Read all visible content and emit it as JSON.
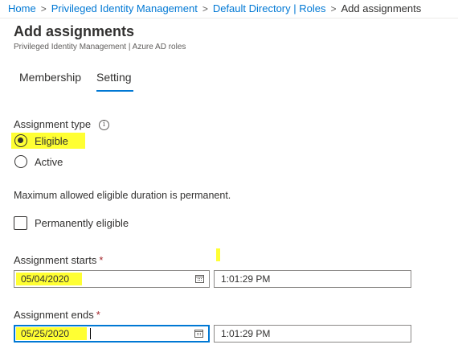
{
  "breadcrumb": {
    "items": [
      "Home",
      "Privileged Identity Management",
      "Default Directory | Roles"
    ],
    "current": "Add assignments",
    "separator": ">"
  },
  "header": {
    "title": "Add assignments",
    "subtitle": "Privileged Identity Management | Azure AD roles"
  },
  "tabs": [
    {
      "label": "Membership",
      "selected": false
    },
    {
      "label": "Setting",
      "selected": true
    }
  ],
  "form": {
    "assignment_type": {
      "label": "Assignment type",
      "info_icon": "info-icon",
      "info_glyph": "i",
      "options": [
        {
          "label": "Eligible",
          "selected": true
        },
        {
          "label": "Active",
          "selected": false
        }
      ]
    },
    "max_duration_text": "Maximum allowed eligible duration is permanent.",
    "permanently_eligible": {
      "label": "Permanently eligible",
      "checked": false
    },
    "assignment_starts": {
      "label": "Assignment starts",
      "required_mark": "*",
      "date": "05/04/2020",
      "time": "1:01:29 PM"
    },
    "assignment_ends": {
      "label": "Assignment ends",
      "required_mark": "*",
      "date": "05/25/2020",
      "time": "1:01:29 PM"
    }
  },
  "colors": {
    "accent": "#0078d4",
    "highlight": "#ffff33",
    "required": "#a4262c"
  }
}
